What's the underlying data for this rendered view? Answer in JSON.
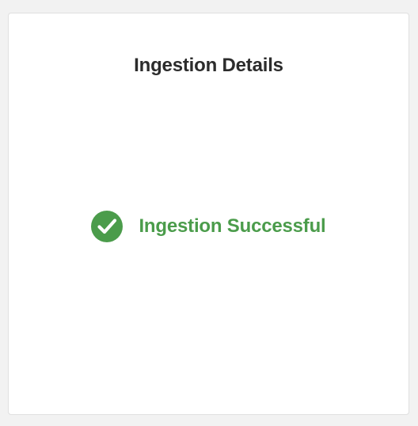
{
  "card": {
    "title": "Ingestion Details",
    "status": {
      "text": "Ingestion Successful",
      "icon": "checkmark-circle-icon",
      "color": "#4b9c4b"
    }
  },
  "colors": {
    "background": "#f2f2f2",
    "card": "#ffffff",
    "title": "#2c2c2c",
    "success": "#4b9c4b"
  }
}
